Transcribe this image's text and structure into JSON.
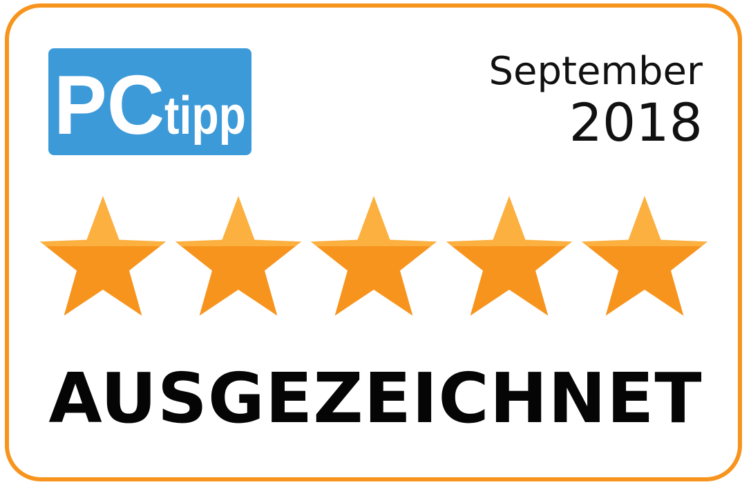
{
  "logo": {
    "brand_big": "PC",
    "brand_small": "tipp",
    "background_color": "#3d9ad9"
  },
  "date": {
    "month": "September",
    "year": "2018"
  },
  "rating": {
    "stars_filled": 5,
    "stars_total": 5,
    "star_color_top": "#fbb040",
    "star_color_bottom": "#f7941d"
  },
  "headline": "AUSGEZEICHNET",
  "border_color": "#f7941d"
}
